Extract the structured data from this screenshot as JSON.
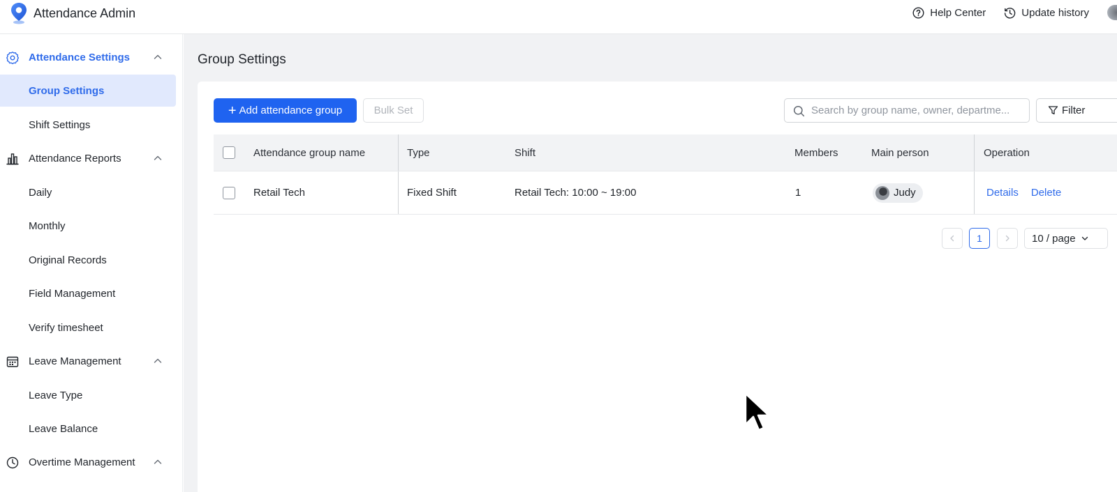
{
  "app": {
    "title": "Attendance Admin",
    "accent_color": "#2f6bea",
    "primary_button_color": "#1f63f0"
  },
  "header": {
    "help_label": "Help Center",
    "help_icon": "question-circle-icon",
    "history_label": "Update history",
    "history_icon": "history-icon"
  },
  "sidebar": {
    "groups": [
      {
        "label": "Attendance Settings",
        "icon": "gear-icon",
        "expanded": true,
        "active": true,
        "items": [
          {
            "label": "Group Settings",
            "selected": true
          },
          {
            "label": "Shift Settings"
          }
        ]
      },
      {
        "label": "Attendance Reports",
        "icon": "bar-chart-icon",
        "expanded": true,
        "items": [
          {
            "label": "Daily"
          },
          {
            "label": "Monthly"
          },
          {
            "label": "Original Records"
          },
          {
            "label": "Field Management"
          },
          {
            "label": "Verify timesheet"
          }
        ]
      },
      {
        "label": "Leave Management",
        "icon": "calendar-icon",
        "expanded": true,
        "items": [
          {
            "label": "Leave Type"
          },
          {
            "label": "Leave Balance"
          }
        ]
      },
      {
        "label": "Overtime Management",
        "icon": "clock-icon",
        "expanded": true,
        "items": []
      }
    ]
  },
  "main": {
    "page_title": "Group Settings",
    "toolbar": {
      "add_label": "Add attendance group",
      "bulk_label": "Bulk Set",
      "search_placeholder": "Search by group name, owner, departme...",
      "filter_label": "Filter"
    },
    "table": {
      "columns": [
        "Attendance group name",
        "Type",
        "Shift",
        "Members",
        "Main person",
        "Operation"
      ],
      "rows": [
        {
          "name": "Retail Tech",
          "type": "Fixed Shift",
          "shift": "Retail Tech: 10:00 ~ 19:00",
          "members": "1",
          "main_person": "Judy",
          "actions": [
            "Details",
            "Delete"
          ]
        }
      ]
    },
    "pagination": {
      "current_page": "1",
      "page_size": "10 / page"
    }
  }
}
